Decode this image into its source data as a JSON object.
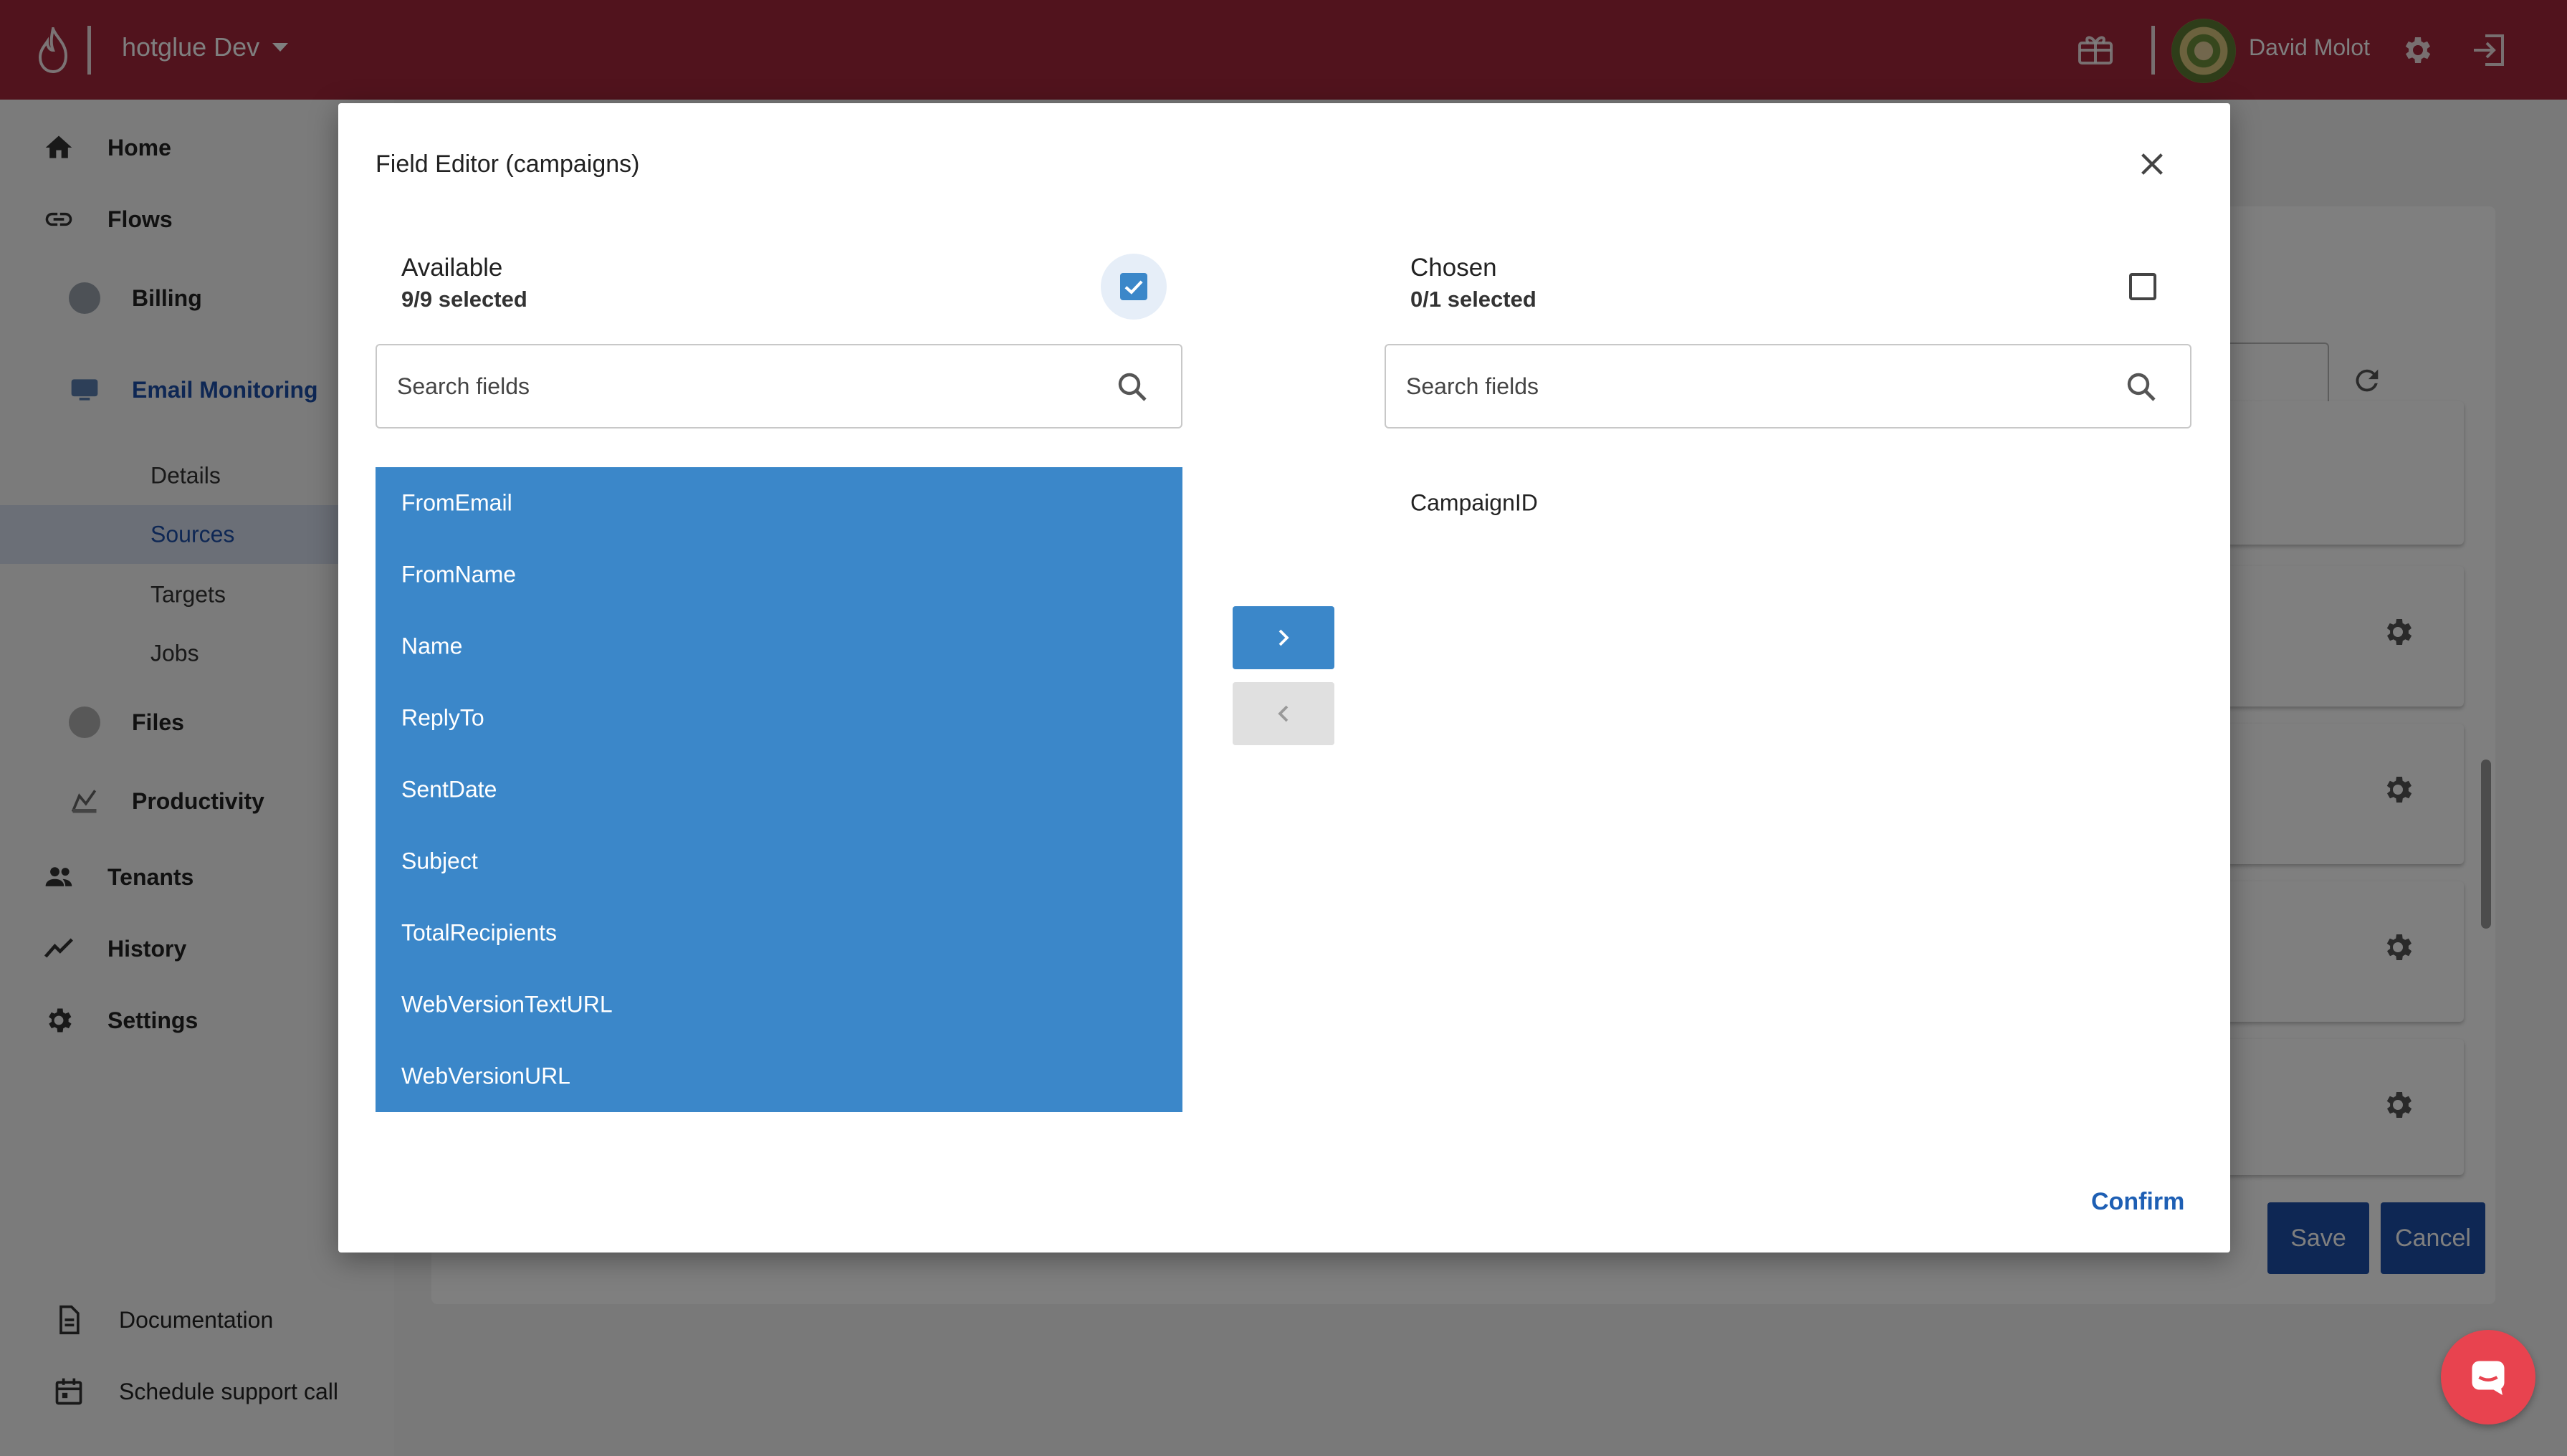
{
  "topbar": {
    "org_name": "hotglue Dev",
    "user_name": "David Molot"
  },
  "sidebar": {
    "items": [
      {
        "label": "Home"
      },
      {
        "label": "Flows"
      },
      {
        "label": "Billing"
      },
      {
        "label": "Email Monitoring"
      },
      {
        "label": "Details"
      },
      {
        "label": "Sources"
      },
      {
        "label": "Targets"
      },
      {
        "label": "Jobs"
      },
      {
        "label": "Files"
      },
      {
        "label": "Productivity"
      },
      {
        "label": "Tenants"
      },
      {
        "label": "History"
      },
      {
        "label": "Settings"
      }
    ],
    "footer": [
      {
        "label": "Documentation"
      },
      {
        "label": "Schedule support call"
      }
    ]
  },
  "background": {
    "save_label": "Save",
    "cancel_label": "Cancel"
  },
  "modal": {
    "title": "Field Editor (campaigns)",
    "available": {
      "title": "Available",
      "selected_text": "9/9 selected",
      "search_placeholder": "Search fields",
      "all_checked": true,
      "fields": [
        "FromEmail",
        "FromName",
        "Name",
        "ReplyTo",
        "SentDate",
        "Subject",
        "TotalRecipients",
        "WebVersionTextURL",
        "WebVersionURL"
      ]
    },
    "chosen": {
      "title": "Chosen",
      "selected_text": "0/1 selected",
      "search_placeholder": "Search fields",
      "all_checked": false,
      "fields": [
        "CampaignID"
      ]
    },
    "confirm_label": "Confirm"
  },
  "colors": {
    "topbar": "#a3263a",
    "accent_blue": "#3b87c9",
    "brand_blue": "#1d4fa8",
    "chat": "#e8434f"
  }
}
